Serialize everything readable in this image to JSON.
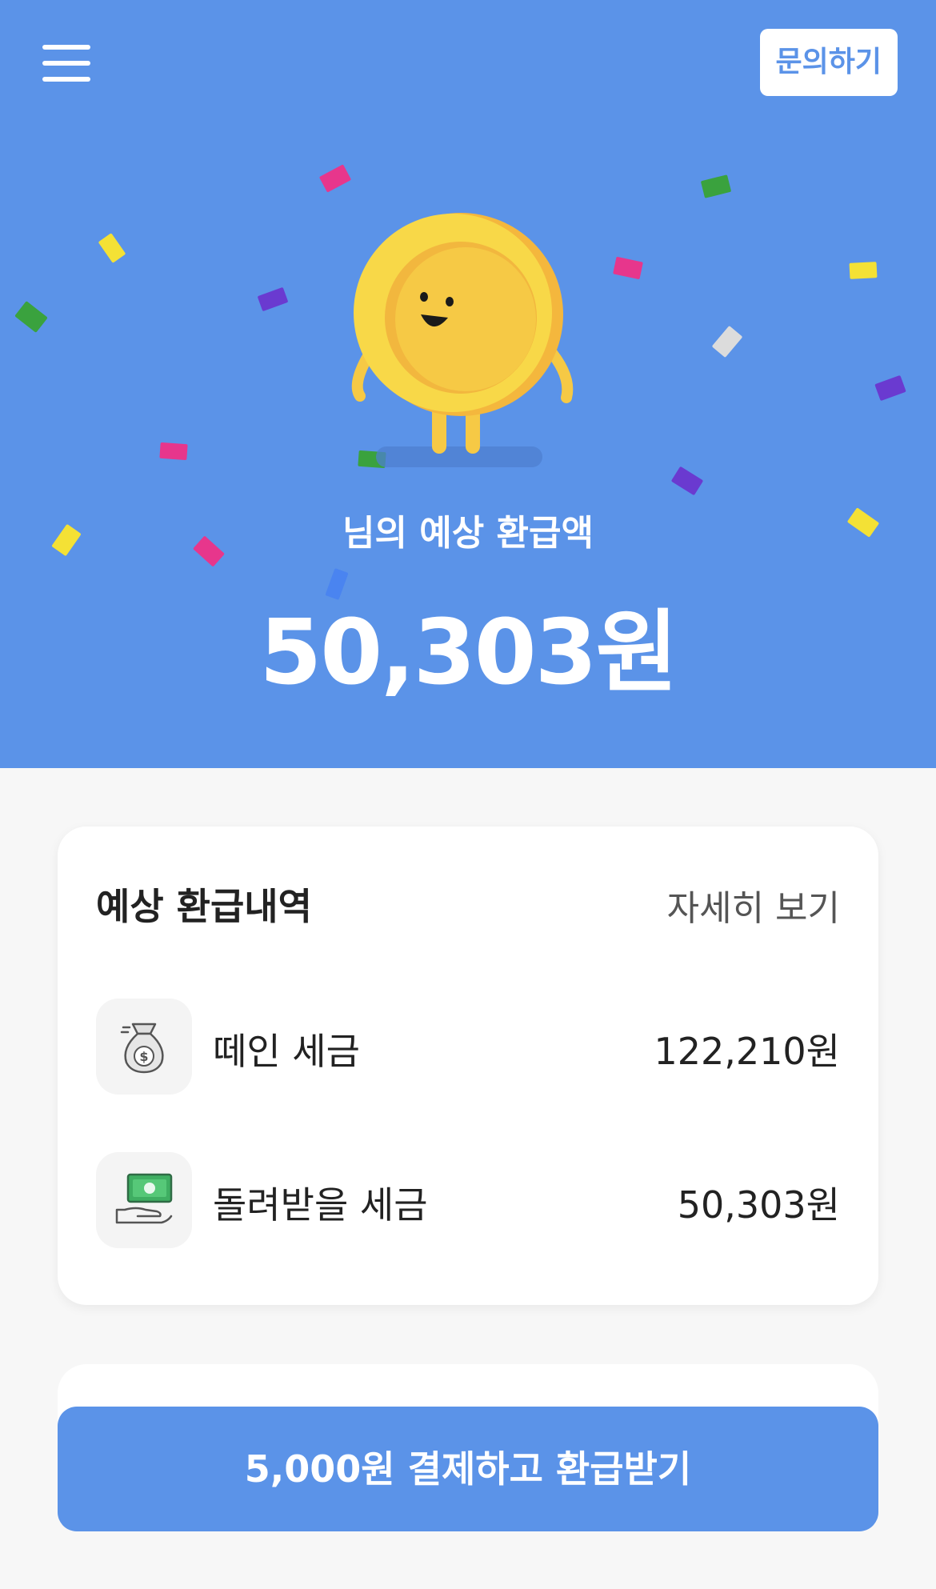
{
  "header": {
    "contact_label": "문의하기"
  },
  "hero": {
    "subtitle": "님의 예상 환급액",
    "amount": "50,303원"
  },
  "refund_card": {
    "title": "예상 환급내역",
    "detail_link": "자세히 보기",
    "rows": [
      {
        "icon": "money-bag-icon",
        "label": "떼인 세금",
        "value": "122,210원"
      },
      {
        "icon": "cash-in-hand-icon",
        "label": "돌려받을 세금",
        "value": "50,303원"
      }
    ]
  },
  "cta": {
    "label": "5,000원 결제하고 환급받기"
  },
  "colors": {
    "primary": "#5b93e8",
    "white": "#ffffff",
    "coin": "#f6c945",
    "coin_inner": "#f4b73d"
  }
}
